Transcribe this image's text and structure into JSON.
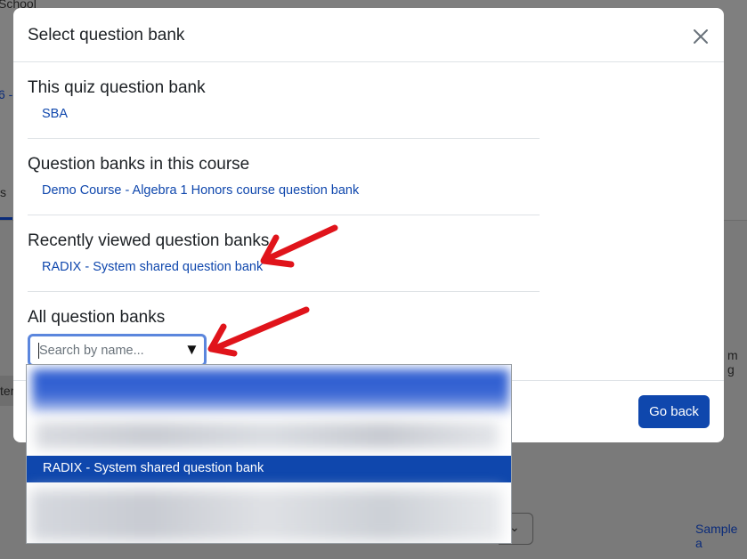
{
  "background": {
    "top_text": "School",
    "left_fragment": "6 -",
    "tab_fragment": "s",
    "left_strip_text": "ter",
    "right_fragment": "m g",
    "sample_link": "Sample a"
  },
  "modal": {
    "title": "Select question bank",
    "close_icon": "close-icon",
    "sections": {
      "quiz_bank": {
        "title": "This quiz question bank",
        "link": "SBA"
      },
      "course_banks": {
        "title": "Question banks in this course",
        "link": "Demo Course - Algebra 1 Honors course question bank"
      },
      "recent_banks": {
        "title": "Recently viewed question banks",
        "link": "RADIX - System shared question bank"
      },
      "all_banks": {
        "title": "All question banks",
        "search_placeholder": "Search by name...",
        "dropdown_icon": "triangle-down-icon"
      }
    },
    "footer": {
      "go_back_label": "Go back"
    }
  },
  "dropdown": {
    "selected_option": "RADIX - System shared question bank"
  },
  "colors": {
    "primary": "#0f47ad",
    "link": "#0f47ad",
    "annotation_arrow": "#e0141b",
    "focus_ring": "#5b86dd"
  }
}
